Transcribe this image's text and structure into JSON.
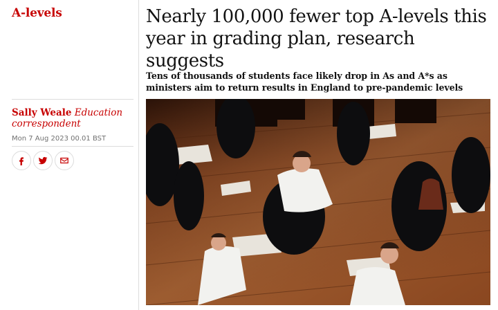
{
  "section": {
    "label": "A-levels"
  },
  "article": {
    "headline": "Nearly 100,000 fewer top A-levels this year in grading plan, research suggests",
    "standfirst": "Tens of thousands of students face likely drop in As and A*s as ministers aim to return results in England to pre-pandemic levels",
    "byline": {
      "author": "Sally Weale",
      "role": "Education correspondent"
    },
    "dateline": "Mon 7 Aug 2023 00.01 BST"
  },
  "share": [
    {
      "name": "facebook",
      "icon": "facebook-icon"
    },
    {
      "name": "twitter",
      "icon": "twitter-icon"
    },
    {
      "name": "email",
      "icon": "email-icon"
    }
  ],
  "image": {
    "subject": "students sitting exams in a hall"
  },
  "colors": {
    "accent": "#c70000",
    "text": "#121212",
    "muted": "#707070",
    "rule": "#dcdcdc"
  }
}
